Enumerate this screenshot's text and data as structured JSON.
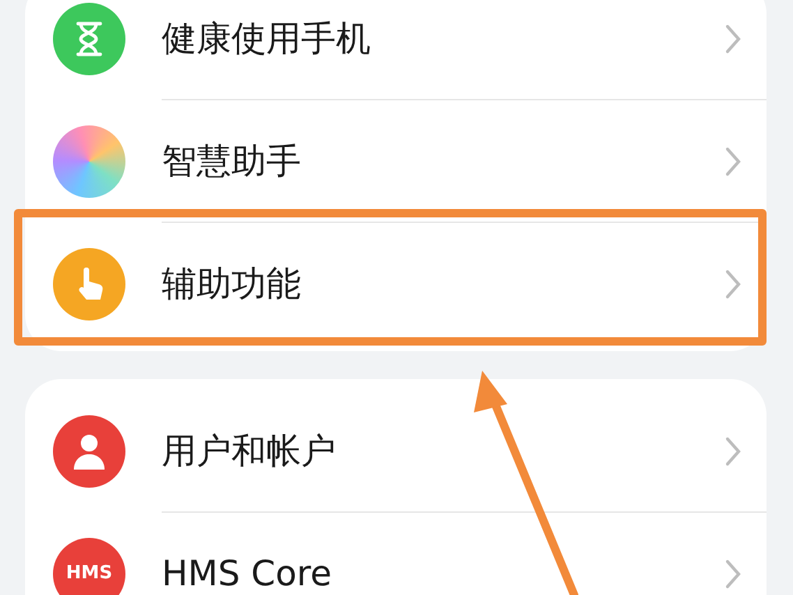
{
  "groups": [
    {
      "items": [
        {
          "label": "健康使用手机",
          "highlighted": false
        },
        {
          "label": "智慧助手",
          "highlighted": false
        },
        {
          "label": "辅助功能",
          "highlighted": true
        }
      ]
    },
    {
      "items": [
        {
          "label": "用户和帐户",
          "highlighted": false
        },
        {
          "label": "HMS Core",
          "icon_text": "HMS",
          "highlighted": false
        }
      ]
    }
  ],
  "annotation": {
    "kind": "arrow"
  }
}
